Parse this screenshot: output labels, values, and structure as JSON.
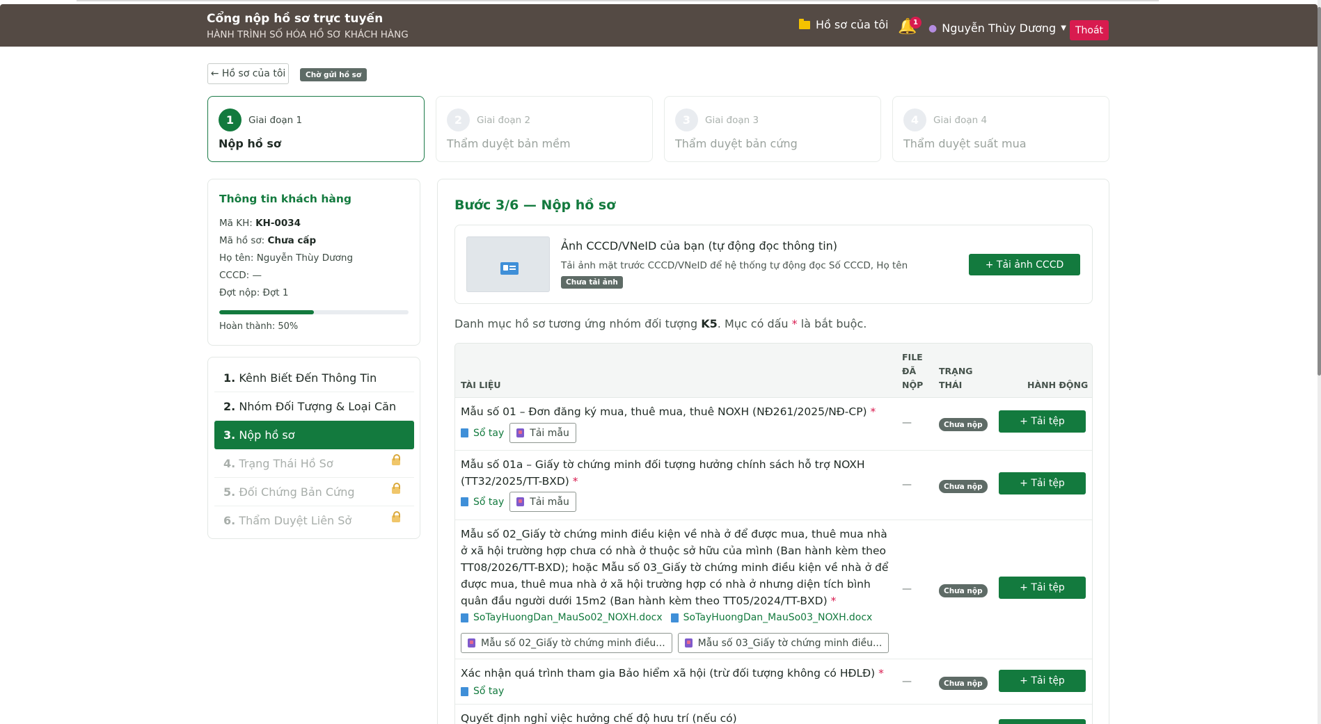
{
  "header": {
    "title": "Cổng nộp hồ sơ trực tuyến",
    "subtitle": "HÀNH TRÌNH SỐ HÓA HỒ SƠ KHÁCH HÀNG",
    "my_files": "Hồ sơ của tôi",
    "notification_count": "1",
    "user_name": "Nguyễn Thùy Dương",
    "logout": "Thoát",
    "accent_color": "#137a3e",
    "danger_color": "#d81b4f"
  },
  "toolbar": {
    "back": "← Hồ sơ của tôi",
    "status": "Chờ gửi hồ sơ"
  },
  "stages": [
    {
      "num": "1",
      "label": "Giai đoạn 1",
      "name": "Nộp hồ sơ",
      "active": true
    },
    {
      "num": "2",
      "label": "Giai đoạn 2",
      "name": "Thẩm duyệt bản mềm",
      "active": false
    },
    {
      "num": "3",
      "label": "Giai đoạn 3",
      "name": "Thẩm duyệt bản cứng",
      "active": false
    },
    {
      "num": "4",
      "label": "Giai đoạn 4",
      "name": "Thẩm duyệt suất mua",
      "active": false
    }
  ],
  "customer": {
    "title": "Thông tin khách hàng",
    "code_label": "Mã KH:",
    "code": "KH-0034",
    "file_label": "Mã hồ sơ:",
    "file": "Chưa cấp",
    "name_label": "Họ tên:",
    "name": "Nguyễn Thùy Dương",
    "id_label": "CCCD:",
    "id": "—",
    "batch_label": "Đợt nộp:",
    "batch": "Đợt 1",
    "progress": 0.5,
    "progress_text": "Hoàn thành: 50%"
  },
  "steps": [
    {
      "num": "1.",
      "label": "Kênh Biết Đến Thông Tin",
      "state": "done"
    },
    {
      "num": "2.",
      "label": "Nhóm Đối Tượng & Loại Căn",
      "state": "done"
    },
    {
      "num": "3.",
      "label": "Nộp hồ sơ",
      "state": "active"
    },
    {
      "num": "4.",
      "label": "Trạng Thái Hồ Sơ",
      "state": "locked"
    },
    {
      "num": "5.",
      "label": "Đối Chứng Bản Cứng",
      "state": "locked"
    },
    {
      "num": "6.",
      "label": "Thẩm Duyệt Liên Sở",
      "state": "locked"
    }
  ],
  "main": {
    "title": "Bước 3/6 — Nộp hồ sơ",
    "id_upload": {
      "title": "Ảnh CCCD/VNeID của bạn (tự động đọc thông tin)",
      "desc": "Tải ảnh mặt trước CCCD/VNeID để hệ thống tự động đọc Số CCCD, Họ tên",
      "badge": "Chưa tải ảnh",
      "button": "+ Tải ảnh CCCD"
    },
    "note_prefix": "Danh mục hồ sơ tương ứng nhóm đối tượng ",
    "note_group": "K5",
    "note_mid": ". Mục có dấu ",
    "note_star": "*",
    "note_suffix": " là bắt buộc."
  },
  "table": {
    "headers": {
      "doc": "TÀI LIỆU",
      "file_l1": "FILE",
      "file_l2": "ĐÃ",
      "file_l3": "NỘP",
      "status_l1": "TRẠNG",
      "status_l2": "THÁI",
      "action": "HÀNH ĐỘNG"
    },
    "star": "*",
    "dash": "—",
    "status": "Chưa nộp",
    "upload": "+ Tải tệp",
    "handbook": "Sổ tay",
    "template": "Tải mẫu",
    "rows": [
      {
        "title": "Mẫu số 01 – Đơn đăng ký mua, thuê mua, thuê NOXH (NĐ261/2025/NĐ-CP)"
      },
      {
        "title": "Mẫu số 01a – Giấy tờ chứng minh đối tượng hưởng chính sách hỗ trợ NOXH (TT32/2025/TT-BXD)"
      },
      {
        "title": "Mẫu số 02_Giấy tờ chứng minh điều kiện về nhà ở để được mua, thuê mua nhà ở xã hội trường hợp chưa có nhà ở thuộc sở hữu của mình (Ban hành kèm theo TT08/2026/TT-BXD); hoặc Mẫu số 03_Giấy tờ chứng minh điều kiện về nhà ở để được mua, thuê mua nhà ở xã hội trường hợp có nhà ở nhưng diện tích bình quân đầu người dưới 15m2 (Ban hành kèm theo TT05/2024/TT-BXD)",
        "link1": "SoTayHuongDan_MauSo02_NOXH.docx",
        "link2": "SoTayHuongDan_MauSo03_NOXH.docx",
        "tpl1": "Mẫu số 02_Giấy tờ chứng minh điều...",
        "tpl2": "Mẫu số 03_Giấy tờ chứng minh điều..."
      },
      {
        "title": "Xác nhận quá trình tham gia Bảo hiểm xã hội (trừ đối tượng không có HĐLĐ)"
      },
      {
        "title": "Quyết định nghỉ việc hưởng chế độ hưu trí (nếu có)"
      }
    ]
  }
}
